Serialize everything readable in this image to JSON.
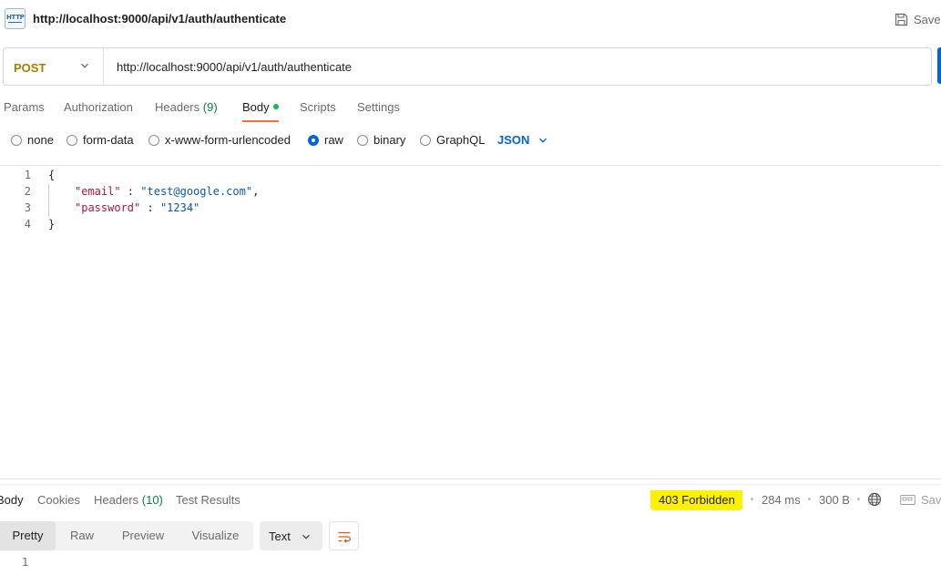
{
  "title_bar": {
    "icon": "http-request-icon",
    "icon_text": "HTTP",
    "title": "http://localhost:9000/api/v1/auth/authenticate",
    "save_label": "Save"
  },
  "request": {
    "method": "POST",
    "url": "http://localhost:9000/api/v1/auth/authenticate"
  },
  "request_tabs": {
    "params": "Params",
    "authorization": "Authorization",
    "headers": "Headers",
    "headers_count": "(9)",
    "body": "Body",
    "scripts": "Scripts",
    "settings": "Settings",
    "active": "Body"
  },
  "body_types": {
    "none": "none",
    "form_data": "form-data",
    "urlencoded": "x-www-form-urlencoded",
    "raw": "raw",
    "binary": "binary",
    "graphql": "GraphQL",
    "selected": "raw",
    "format": "JSON"
  },
  "editor": {
    "line_numbers": [
      "1",
      "2",
      "3",
      "4"
    ],
    "open_brace": "{",
    "email_key": "\"email\"",
    "email_sep": " : ",
    "email_value": "\"test@google.com\"",
    "email_comma": ",",
    "password_key": "\"password\"",
    "password_sep": " : ",
    "password_value": "\"1234\"",
    "close_brace": "}"
  },
  "response_tabs": {
    "body": "Body",
    "cookies": "Cookies",
    "headers": "Headers",
    "headers_count": "(10)",
    "test_results": "Test Results",
    "active": "Body"
  },
  "response_meta": {
    "status": "403 Forbidden",
    "time": "284 ms",
    "size": "300 B",
    "save_label": "Save"
  },
  "response_view": {
    "modes": [
      "Pretty",
      "Raw",
      "Preview",
      "Visualize"
    ],
    "active_mode": "Pretty",
    "format": "Text",
    "line_numbers": [
      "1"
    ]
  },
  "colors": {
    "method": "#ad7a03",
    "accent_blue": "#0265d2",
    "tab_underline": "#ff6c37",
    "status_highlight": "#fff200",
    "json_key": "#a8193b",
    "json_string": "#0b58a6",
    "count_green": "#0a7f3f"
  }
}
